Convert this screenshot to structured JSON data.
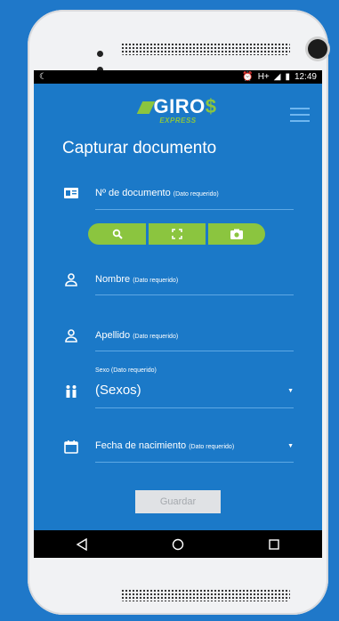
{
  "status_bar": {
    "time": "12:49",
    "network": "H+"
  },
  "header": {
    "logo_text": "GIRO",
    "logo_dollar": "$",
    "logo_sub": "EXPRESS"
  },
  "page": {
    "title": "Capturar documento"
  },
  "form": {
    "document": {
      "label": "Nº de documento",
      "required": "(Dato requerido)"
    },
    "name": {
      "label": "Nombre",
      "required": "(Dato requerido)"
    },
    "surname": {
      "label": "Apellido",
      "required": "(Dato requerido)"
    },
    "sex": {
      "caption": "Sexo (Dato requerido)",
      "value": "(Sexos)"
    },
    "birthdate": {
      "label": "Fecha de nacimiento",
      "required": "(Dato requerido)"
    },
    "save_label": "Guardar"
  },
  "icons": {
    "document": "id-card-icon",
    "search": "search-icon",
    "scan": "scan-frame-icon",
    "camera": "camera-icon",
    "person": "person-icon",
    "people": "people-icon",
    "calendar": "calendar-icon",
    "back": "back-icon",
    "home": "home-icon",
    "recents": "recents-icon"
  },
  "colors": {
    "screen_bg": "#1b79c8",
    "accent_green": "#8bc53f",
    "outer_bg": "#1f78c9"
  }
}
